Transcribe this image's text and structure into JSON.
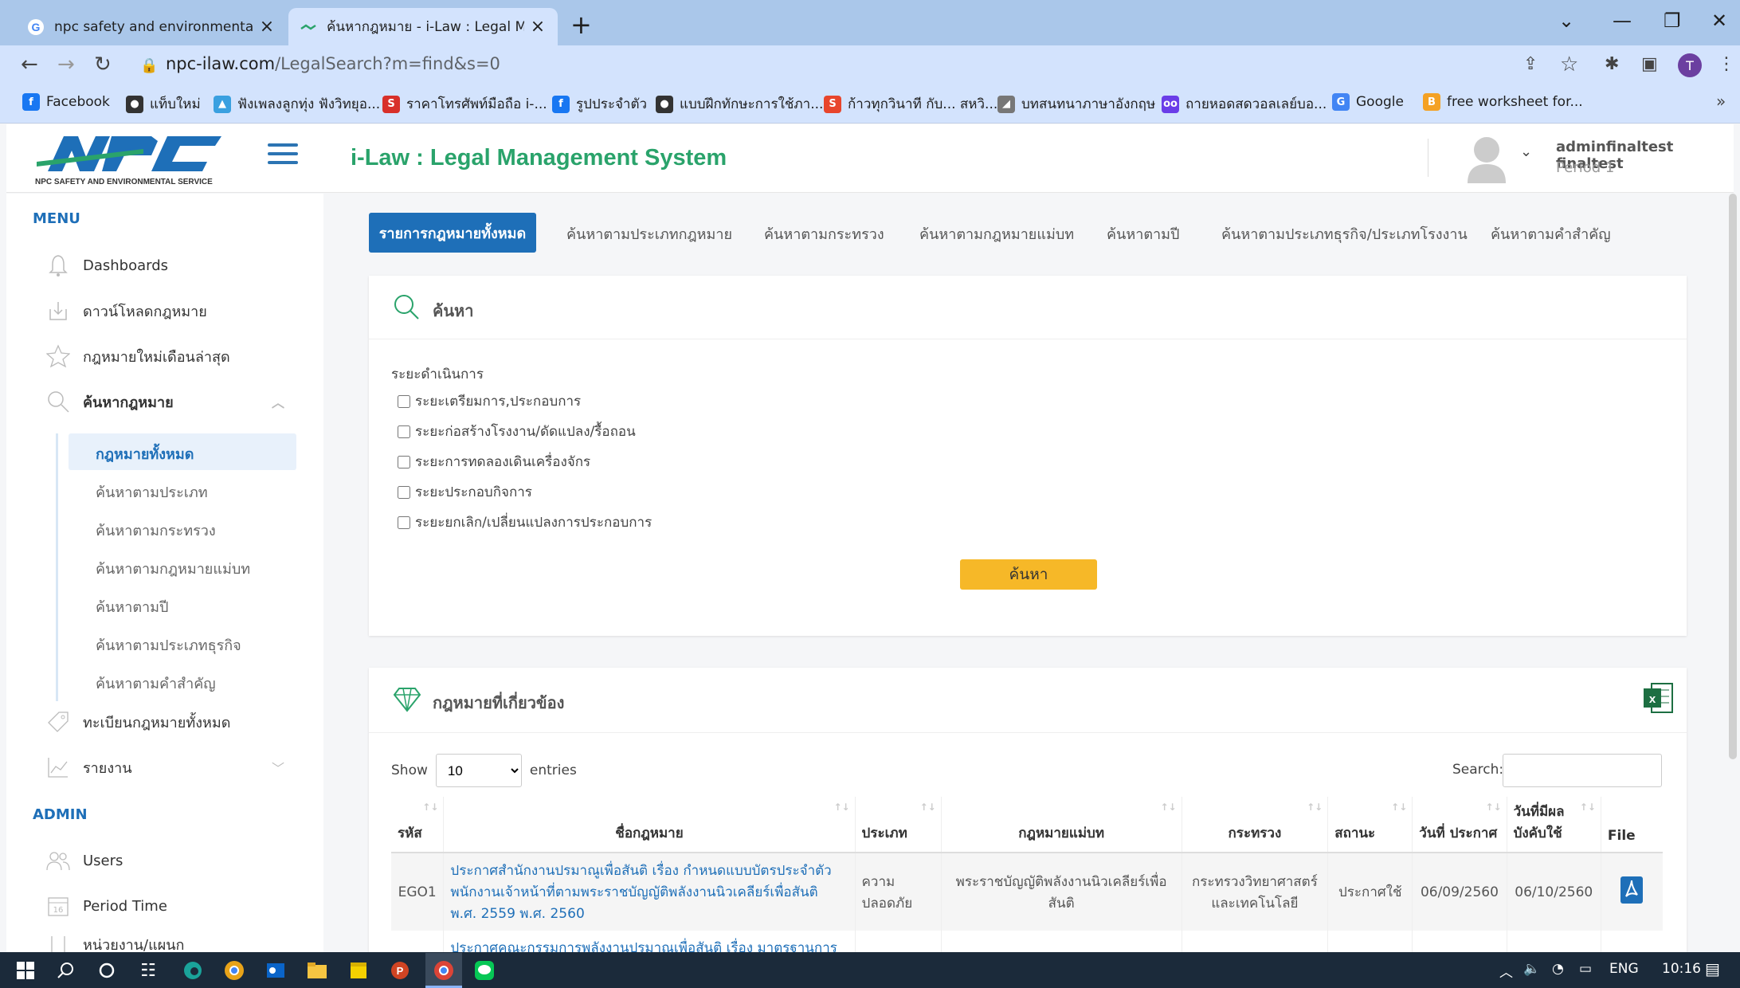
{
  "browser": {
    "tabs": [
      {
        "label": "npc safety and environmental se",
        "icon": "google-icon"
      },
      {
        "label": "ค้นหากฎหมาย - i-Law : Legal Mana",
        "icon": "npc-icon",
        "active": true
      }
    ],
    "url_host": "npc-ilaw.com",
    "url_path": "/LegalSearch?m=find&s=0",
    "profile_initial": "T",
    "bookmarks": [
      {
        "label": "Facebook",
        "color": "#1877f2",
        "glyph": "f"
      },
      {
        "label": "แท็บใหม่",
        "color": "#333333",
        "glyph": "●"
      },
      {
        "label": "ฟังเพลงลูกทุ่ง ฟังวิทยุอ...",
        "color": "#3aa0e0",
        "glyph": "▲"
      },
      {
        "label": "ราคาโทรศัพท์มือถือ i-...",
        "color": "#d8302a",
        "glyph": "S"
      },
      {
        "label": "รูปประจำตัว",
        "color": "#1877f2",
        "glyph": "f"
      },
      {
        "label": "แบบฝึกทักษะการใช้ภา...",
        "color": "#333333",
        "glyph": "●"
      },
      {
        "label": "ก้าวทุกวินาที กับ... สหวิ...",
        "color": "#e8452c",
        "glyph": "S"
      },
      {
        "label": "บทสนทนาภาษาอังกฤษ",
        "color": "#777777",
        "glyph": "◢"
      },
      {
        "label": "ถายหอดสดวอลเลย์บอ...",
        "color": "#6a3de8",
        "glyph": "oo"
      },
      {
        "label": "Google",
        "color": "#4285f4",
        "glyph": "G"
      },
      {
        "label": "free worksheet for...",
        "color": "#f4a124",
        "glyph": "B"
      }
    ],
    "more_bookmarks": "»"
  },
  "header": {
    "logo_text": "NPC SAFETY AND ENVIRONMENTAL SERVICE",
    "logo_mark": "NPC",
    "title": "i-Law : Legal Management System",
    "username": "adminfinaltest finaltest",
    "period": "Period 1"
  },
  "sidebar": {
    "menu_label": "MENU",
    "items": [
      {
        "label": "Dashboards",
        "icon": "bell-icon"
      },
      {
        "label": "ดาวน์โหลดกฎหมาย",
        "icon": "download-icon"
      },
      {
        "label": "กฎหมายใหม่เดือนล่าสุด",
        "icon": "star-icon"
      },
      {
        "label": "ค้นหากฎหมาย",
        "icon": "search-icon"
      }
    ],
    "subitems": [
      "กฎหมายทั้งหมด",
      "ค้นหาตามประเภท",
      "ค้นหาตามกระทรวง",
      "ค้นหาตามกฎหมายแม่บท",
      "ค้นหาตามปี",
      "ค้นหาตามประเภทธุรกิจ",
      "ค้นหาตามคำสำคัญ"
    ],
    "items2": [
      {
        "label": "ทะเบียนกฎหมายทั้งหมด",
        "icon": "tag-icon"
      },
      {
        "label": "รายงาน",
        "icon": "chart-icon"
      }
    ],
    "admin_label": "ADMIN",
    "admin_items": [
      {
        "label": "Users",
        "icon": "users-icon"
      },
      {
        "label": "Period Time",
        "icon": "calendar-icon",
        "glyph": "16"
      },
      {
        "label": "หน่วยงาน/แผนก",
        "icon": "building-icon"
      }
    ]
  },
  "topnav": [
    "รายการกฎหมายทั้งหมด",
    "ค้นหาตามประเภทกฎหมาย",
    "ค้นหาตามกระทรวง",
    "ค้นหาตามกฎหมายแม่บท",
    "ค้นหาตามปี",
    "ค้นหาตามประเภทธุรกิจ/ประเภทโรงงาน",
    "ค้นหาตามคำสำคัญ"
  ],
  "search_card": {
    "title": "ค้นหา",
    "phase_label": "ระยะดำเนินการ",
    "checkboxes": [
      "ระยะเตรียมการ,ประกอบการ",
      "ระยะก่อสร้างโรงงาน/ดัดแปลง/รื้อถอน",
      "ระยะการทดลองเดินเครื่องจักร",
      "ระยะประกอบกิจการ",
      "ระยะยกเลิก/เปลี่ยนแปลงการประกอบการ"
    ],
    "button": "ค้นหา"
  },
  "results": {
    "title": "กฎหมายที่เกี่ยวข้อง",
    "show_label": "Show",
    "page_size": "10",
    "entries_label": "entries",
    "search_label": "Search:",
    "columns": [
      "รหัส",
      "ชื่อกฎหมาย",
      "ประเภท",
      "กฎหมายแม่บท",
      "กระทรวง",
      "สถานะ",
      "วันที่ ประกาศ",
      "วันที่มีผล บังคับใช้",
      "File"
    ],
    "rows": [
      {
        "code": "EGO1",
        "name": "ประกาศสำนักงานปรมาณูเพื่อสันติ เรื่อง กำหนดแบบบัตรประจำตัว พนักงานเจ้าหน้าที่ตามพระราชบัญญัติพลังงานนิวเคลียร์เพื่อสันติ พ.ศ. 2559 พ.ศ. 2560",
        "type": "ความ ปลอดภัย",
        "parent": "พระราชบัญญัติพลังงานนิวเคลียร์เพื่อ สันติ",
        "ministry": "กระทรวงวิทยาศาสตร์ และเทคโนโลยี",
        "status": "ประกาศใช้",
        "announced": "06/09/2560",
        "effective": "06/10/2560"
      },
      {
        "code": "",
        "name": "ประกาศคณะกรรมการพลังงานปรมาณูเพื่อสันติ เรื่อง มาตรฐานการ",
        "type": "",
        "parent": "",
        "ministry": "",
        "status": "",
        "announced": "",
        "effective": ""
      }
    ]
  },
  "taskbar": {
    "lang": "ENG",
    "time": "10:16"
  },
  "colors": {
    "accent_blue": "#1e6fb8",
    "title_green": "#2aa36b",
    "search_button": "#f6b828",
    "chrome_bar": "#d3e3fd"
  }
}
